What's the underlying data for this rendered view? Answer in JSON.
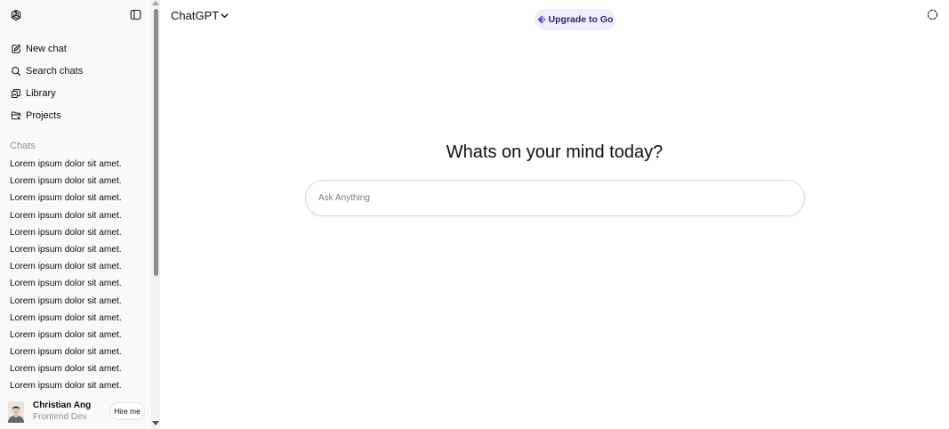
{
  "sidebar": {
    "nav": [
      {
        "label": "New chat",
        "icon": "pencil-square-icon"
      },
      {
        "label": "Search chats",
        "icon": "search-icon"
      },
      {
        "label": "Library",
        "icon": "library-icon"
      },
      {
        "label": "Projects",
        "icon": "folder-icon"
      }
    ],
    "chats_heading": "Chats",
    "chats": [
      "Lorem ipsum dolor sit amet.",
      "Lorem ipsum dolor sit amet.",
      "Lorem ipsum dolor sit amet.",
      "Lorem ipsum dolor sit amet.",
      "Lorem ipsum dolor sit amet.",
      "Lorem ipsum dolor sit amet.",
      "Lorem ipsum dolor sit amet.",
      "Lorem ipsum dolor sit amet.",
      "Lorem ipsum dolor sit amet.",
      "Lorem ipsum dolor sit amet.",
      "Lorem ipsum dolor sit amet.",
      "Lorem ipsum dolor sit amet.",
      "Lorem ipsum dolor sit amet.",
      "Lorem ipsum dolor sit amet."
    ],
    "user": {
      "name": "Christian Ang",
      "role": "Frontend Dev",
      "hire_label": "Hire me"
    }
  },
  "header": {
    "model_label": "ChatGPT",
    "upgrade_label": "Upgrade to Go"
  },
  "main": {
    "headline": "Whats on your mind today?",
    "composer_placeholder": "Ask Anything",
    "composer_value": ""
  },
  "colors": {
    "sidebar_bg": "#f9f9f9",
    "upgrade_bg": "#efedfb",
    "upgrade_text": "#2e1f7a",
    "upgrade_icon": "#5b4bd6"
  }
}
